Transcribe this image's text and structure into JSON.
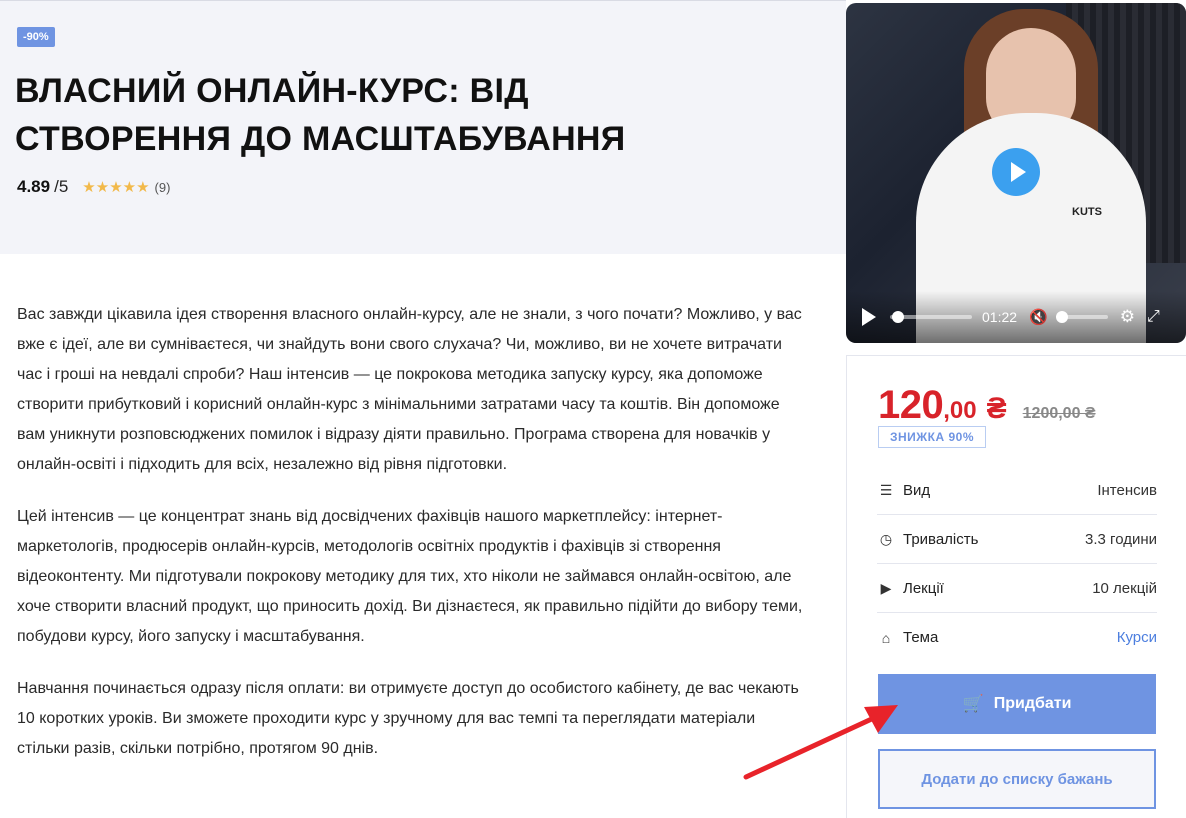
{
  "hero": {
    "discount_badge": "-90%",
    "title": "ВЛАСНИЙ ОНЛАЙН-КУРС: ВІД СТВОРЕННЯ ДО МАСШТАБУВАННЯ",
    "rating_score": "4.89",
    "rating_out_of": "/5",
    "rating_stars": 4.89,
    "reviews_count": "(9)"
  },
  "description": {
    "paragraphs": [
      "Вас завжди цікавила ідея створення власного онлайн-курсу, але не знали, з чого почати? Можливо, у вас вже є ідеї, але ви сумніваєтеся, чи знайдуть вони свого слухача? Чи, можливо, ви не хочете витрачати час і гроші на невдалі спроби? Наш інтенсив — це покрокова методика запуску курсу, яка допоможе створити прибутковий і корисний онлайн-курс з мінімальними затратами часу та коштів.  Він допоможе вам уникнути розповсюджених помилок і відразу діяти правильно. Програма створена для новачків у онлайн-освіті і підходить для всіх, незалежно від рівня підготовки.",
      "Цей інтенсив — це концентрат знань від досвідчених фахівців нашого маркетплейсу: інтернет-маркетологів, продюсерів онлайн-курсів, методологів освітніх продуктів і фахівців зі створення відеоконтенту. Ми підготували покрокову методику для тих, хто ніколи не займався онлайн-освітою, але хоче створити власний продукт, що приносить дохід. Ви дізнаєтеся, як правильно підійти до вибору теми, побудови курсу, його запуску і масштабування.",
      "Навчання починається одразу після оплати: ви отримуєте доступ до особистого кабінету, де вас чекають 10 коротких уроків. Ви зможете проходити курс у зручному для вас темпі та переглядати матеріали стільки разів, скільки потрібно, протягом 90 днів."
    ]
  },
  "video": {
    "hoodie_text": "KUTS",
    "time": "01:22",
    "progress": 0.05,
    "volume": 0.0
  },
  "sidebar": {
    "price_main": "120",
    "price_cents": ",00",
    "currency": "₴",
    "old_price": "1200,00 ₴",
    "discount_label": "ЗНИЖКА 90%",
    "rows": [
      {
        "icon": "sliders-icon",
        "label": "Вид",
        "value": "Інтенсив"
      },
      {
        "icon": "clock-icon",
        "label": "Тривалість",
        "value": "3.3 години"
      },
      {
        "icon": "play-circle-icon",
        "label": "Лекції",
        "value": "10 лекцій"
      },
      {
        "icon": "tag-icon",
        "label": "Тема",
        "value": "Курси"
      }
    ],
    "buy_label": "Придбати",
    "wishlist_label": "Додати до списку бажань"
  },
  "colors": {
    "accent": "#6f94e2",
    "price": "#d8232a",
    "annotation_arrow": "#e8232a"
  }
}
